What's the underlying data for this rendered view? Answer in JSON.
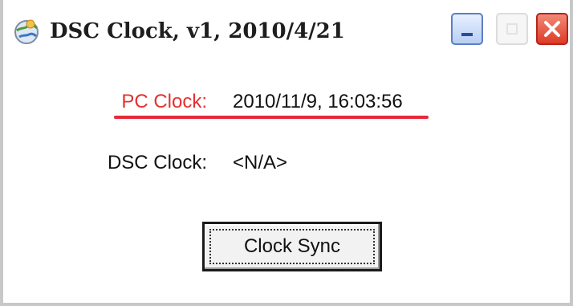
{
  "window": {
    "title": "DSC Clock, v1, 2010/4/21",
    "app_icon": "globe-app-icon",
    "controls": {
      "minimize_icon": "minimize-icon",
      "maximize_icon": "maximize-icon",
      "close_icon": "close-icon"
    }
  },
  "fields": {
    "pc_clock": {
      "label": "PC Clock:",
      "value": "2010/11/9, 16:03:56"
    },
    "dsc_clock": {
      "label": "DSC Clock:",
      "value": "<N/A>"
    }
  },
  "actions": {
    "sync_label": "Clock Sync"
  },
  "colors": {
    "highlight": "#e53030",
    "underline": "#e52a3a",
    "close_button": "#dd3a26",
    "minimize_button": "#5d7fc2"
  }
}
